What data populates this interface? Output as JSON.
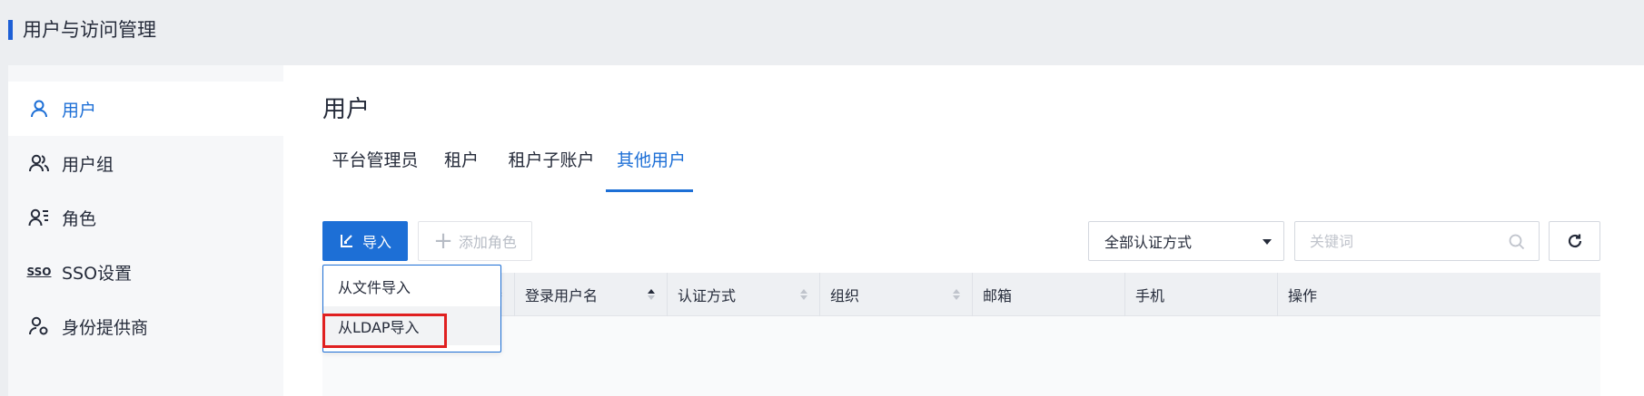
{
  "header": {
    "title": "用户与访问管理",
    "accent_color": "#1d5fd6"
  },
  "sidebar": {
    "items": [
      {
        "label": "用户",
        "icon": "user-icon",
        "active": true
      },
      {
        "label": "用户组",
        "icon": "user-group-icon",
        "active": false
      },
      {
        "label": "角色",
        "icon": "role-icon",
        "active": false
      },
      {
        "label": "SSO设置",
        "icon": "sso-icon",
        "icon_text": "SSO",
        "active": false
      },
      {
        "label": "身份提供商",
        "icon": "identity-provider-icon",
        "active": false
      }
    ]
  },
  "main": {
    "title": "用户",
    "tabs": [
      {
        "label": "平台管理员",
        "active": false
      },
      {
        "label": "租户",
        "active": false
      },
      {
        "label": "租户子账户",
        "active": false
      },
      {
        "label": "其他用户",
        "active": true
      }
    ],
    "toolbar": {
      "import_label": "导入",
      "add_role_label": "添加角色",
      "auth_filter_value": "全部认证方式",
      "search_placeholder": "关键词"
    },
    "table": {
      "columns": [
        {
          "label": "",
          "sortable": true
        },
        {
          "label": "登录用户名",
          "sortable": true,
          "sorted": "asc"
        },
        {
          "label": "认证方式",
          "sortable": true
        },
        {
          "label": "组织",
          "sortable": true
        },
        {
          "label": "邮箱",
          "sortable": false
        },
        {
          "label": "手机",
          "sortable": false
        },
        {
          "label": "操作",
          "sortable": false
        }
      ],
      "rows": []
    },
    "import_menu": {
      "items": [
        {
          "label": "从文件导入",
          "highlighted": false
        },
        {
          "label": "从LDAP导入",
          "highlighted": true
        }
      ]
    }
  },
  "colors": {
    "primary": "#1d6fd6",
    "highlight_box": "#e02020"
  }
}
